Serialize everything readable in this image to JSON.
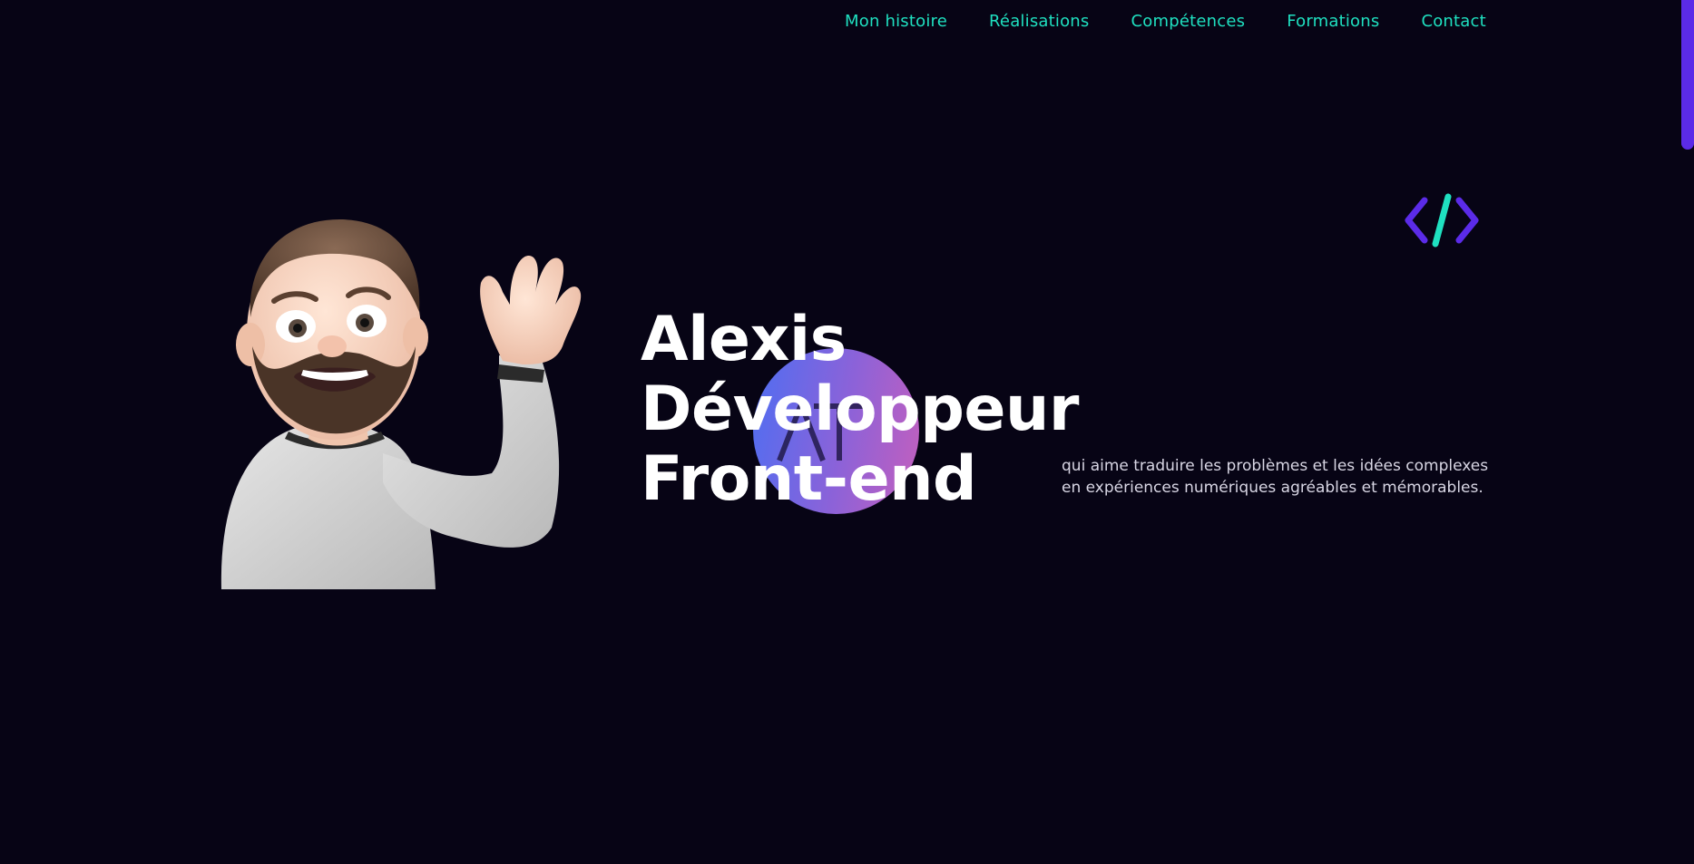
{
  "nav": {
    "items": [
      {
        "label": "Mon histoire"
      },
      {
        "label": "Réalisations"
      },
      {
        "label": "Compétences"
      },
      {
        "label": "Formations"
      },
      {
        "label": "Contact"
      }
    ]
  },
  "hero": {
    "title_lines": [
      "Alexis",
      "Développeur",
      "Front-end"
    ],
    "description": "qui aime traduire les problèmes et les idées complexes en expériences numériques agréables et mémorables.",
    "logo_monogram": "AT"
  },
  "icons": {
    "code_icon": "code-brackets-icon",
    "avatar": "waving-memoji-avatar"
  },
  "colors": {
    "background": "#070415",
    "nav_link": "#1fe0c0",
    "accent_purple": "#5b2be8",
    "accent_teal": "#1fe0c0",
    "heading": "#ffffff"
  }
}
